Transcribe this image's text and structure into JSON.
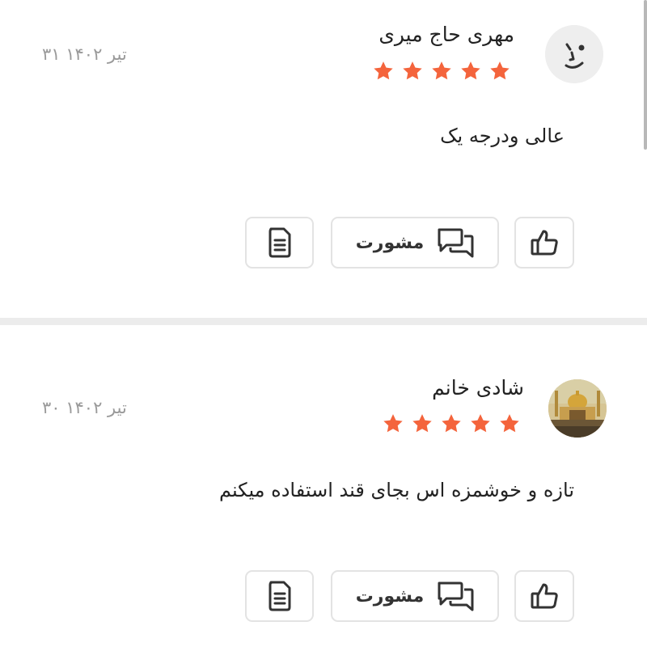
{
  "reviews": [
    {
      "author": "مهری حاج میری",
      "date": "۳۱ تیر ۱۴۰۲",
      "rating": 5,
      "text": "عالی ودرجه یک",
      "avatar": "smiley-face-icon",
      "actions": {
        "consult_label": "مشورت",
        "consult_icon": "chat-bubbles-icon",
        "like_icon": "thumbs-up-icon",
        "report_icon": "document-icon"
      }
    },
    {
      "author": "شادی خانم",
      "date": "۳۰ تیر ۱۴۰۲",
      "rating": 5,
      "text": "تازه و خوشمزه اس بجای قند استفاده میکنم",
      "avatar": "shrine-photo",
      "actions": {
        "consult_label": "مشورت",
        "consult_icon": "chat-bubbles-icon",
        "like_icon": "thumbs-up-icon",
        "report_icon": "document-icon"
      }
    }
  ],
  "colors": {
    "star": "#f4643c",
    "date": "#9a9a9a",
    "border": "#e3e3e3",
    "divider": "#ececec"
  }
}
